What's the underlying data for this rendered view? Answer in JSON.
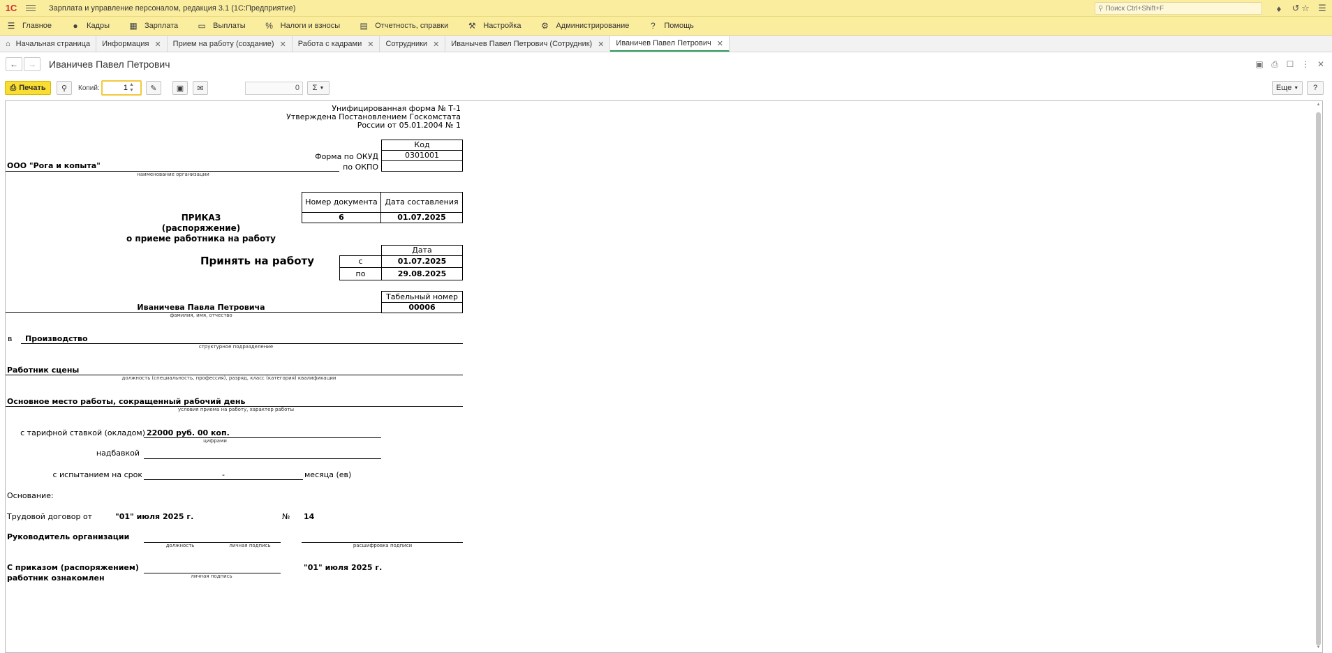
{
  "titlebar": {
    "logo": "1С",
    "title": "Зарплата и управление персоналом, редакция 3.1  (1С:Предприятие)",
    "search_placeholder": "Поиск Ctrl+Shift+F"
  },
  "menu": [
    {
      "label": "Главное",
      "icon": "menu-icon"
    },
    {
      "label": "Кадры",
      "icon": "people-icon"
    },
    {
      "label": "Зарплата",
      "icon": "calculator-icon"
    },
    {
      "label": "Выплаты",
      "icon": "wallet-icon"
    },
    {
      "label": "Налоги и взносы",
      "icon": "percent-icon"
    },
    {
      "label": "Отчетность, справки",
      "icon": "report-icon"
    },
    {
      "label": "Настройка",
      "icon": "wrench-icon"
    },
    {
      "label": "Администрирование",
      "icon": "gear-icon"
    },
    {
      "label": "Помощь",
      "icon": "question-icon"
    }
  ],
  "tabs": [
    {
      "label": "Начальная страница"
    },
    {
      "label": "Информация"
    },
    {
      "label": "Прием на работу (создание)"
    },
    {
      "label": "Работа с кадрами"
    },
    {
      "label": "Сотрудники"
    },
    {
      "label": "Иванычев Павел Петрович (Сотрудник)"
    },
    {
      "label": "Иваничев Павел Петрович"
    }
  ],
  "form": {
    "title": "Иваничев Павел Петрович"
  },
  "toolbar": {
    "print_label": "Печать",
    "copies_label": "Копий:",
    "copies_value": "1",
    "sum_value": "0",
    "sum_button": "Σ",
    "more_label": "Еще",
    "help_label": "?"
  },
  "document": {
    "form_note_1": "Унифицированная форма № Т-1",
    "form_note_2": "Утверждена Постановлением Госкомстата",
    "form_note_3": "России от 05.01.2004 № 1",
    "code_header": "Код",
    "okud_label": "Форма по ОКУД",
    "okud_value": "0301001",
    "okpo_label": "по ОКПО",
    "okpo_value": "",
    "organization": "ООО \"Рога и копыта\"",
    "organization_caption": "наименование организации",
    "doc_number_header": "Номер документа",
    "doc_date_header": "Дата составления",
    "doc_number": "6",
    "doc_date": "01.07.2025",
    "order_title_1": "ПРИКАЗ",
    "order_title_2": "(распоряжение)",
    "order_title_3": "о приеме работника на работу",
    "date_header": "Дата",
    "hire_label": "Принять на работу",
    "from_label": "с",
    "from_date": "01.07.2025",
    "to_label": "по",
    "to_date": "29.08.2025",
    "tab_number_header": "Табельный номер",
    "tab_number": "00006",
    "employee_name": "Иваничева Павла Петровича",
    "employee_caption": "фамилия, имя, отчество",
    "in_label": "в",
    "department": "Производство",
    "department_caption": "структурное подразделение",
    "position": "Работник сцены",
    "position_caption": "должность (специальность, профессия), разряд, класс (категория) квалификации",
    "work_conditions": "Основное место работы, сокращенный рабочий день",
    "work_conditions_caption": "условия приема на работу, характер работы",
    "rate_label": "с тарифной ставкой (окладом)",
    "rate_value": "22000 руб. 00 коп.",
    "rate_caption": "цифрами",
    "bonus_label": "надбавкой",
    "probation_label": "с испытанием на срок",
    "probation_value": "-",
    "probation_unit": "месяца (ев)",
    "basis_label": "Основание:",
    "contract_label": "Трудовой договор от",
    "contract_date": "\"01\" июля 2025 г.",
    "contract_no_label": "№",
    "contract_no": "14",
    "head_label": "Руководитель организации",
    "head_caption_position": "должность",
    "head_caption_signature": "личная подпись",
    "head_caption_decoding": "расшифровка подписи",
    "ack_label_1": "С приказом (распоряжением)",
    "ack_label_2": "работник ознакомлен",
    "ack_caption_signature": "личная подпись",
    "ack_date": "\"01\" июля 2025 г."
  }
}
